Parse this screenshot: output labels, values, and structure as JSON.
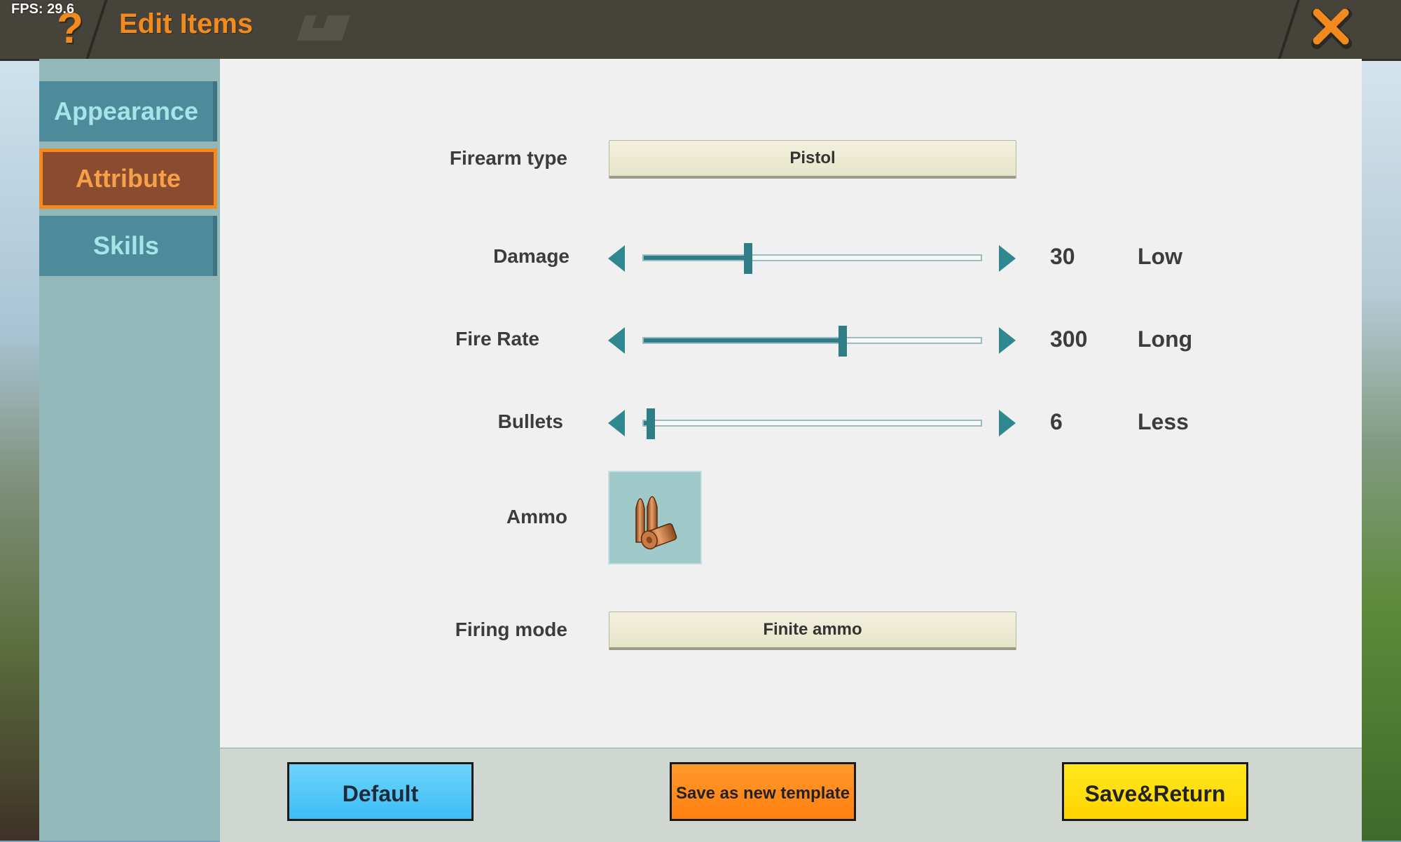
{
  "hud": {
    "fps": "FPS: 29.6"
  },
  "header": {
    "title": "Edit Items",
    "help_symbol": "?",
    "close_icon": "close-x-icon"
  },
  "sidebar": {
    "tabs": [
      {
        "label": "Appearance",
        "active": false
      },
      {
        "label": "Attribute",
        "active": true
      },
      {
        "label": "Skills",
        "active": false
      }
    ]
  },
  "form": {
    "firearm_type": {
      "label": "Firearm type",
      "value": "Pistol"
    },
    "damage": {
      "label": "Damage",
      "value": "30",
      "level": "Low",
      "fraction": 0.31
    },
    "fire_rate": {
      "label": "Fire Rate",
      "value": "300",
      "level": "Long",
      "fraction": 0.59
    },
    "bullets": {
      "label": "Bullets",
      "value": "6",
      "level": "Less",
      "fraction": 0.02
    },
    "ammo": {
      "label": "Ammo",
      "icon": "bullets-icon"
    },
    "firing_mode": {
      "label": "Firing mode",
      "value": "Finite ammo"
    }
  },
  "footer": {
    "default_label": "Default",
    "template_label": "Save as new template",
    "save_label": "Save&Return"
  },
  "colors": {
    "accent_orange": "#f28a1e",
    "teal": "#2f7d86",
    "tab_inactive": "#4e8b9a",
    "tab_active": "#8a4b2e"
  }
}
